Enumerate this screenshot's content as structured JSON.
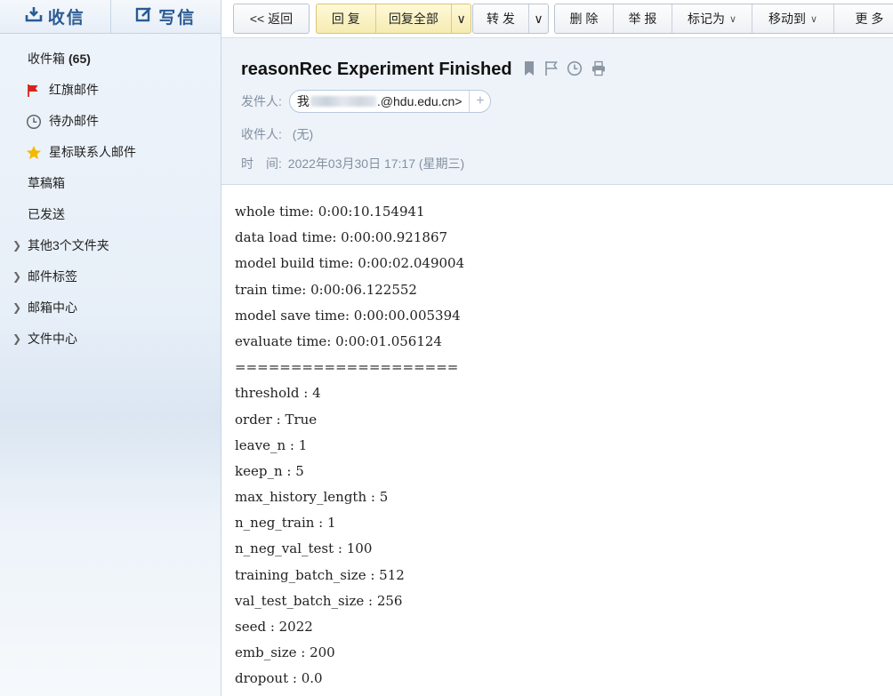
{
  "sidebar": {
    "receive_label": "收信",
    "compose_label": "写信",
    "items": [
      {
        "label": "收件箱",
        "count": "(65)"
      },
      {
        "label": "红旗邮件"
      },
      {
        "label": "待办邮件"
      },
      {
        "label": "星标联系人邮件"
      },
      {
        "label": "草稿箱"
      },
      {
        "label": "已发送"
      },
      {
        "label": "其他3个文件夹"
      },
      {
        "label": "邮件标签"
      },
      {
        "label": "邮箱中心"
      },
      {
        "label": "文件中心"
      }
    ]
  },
  "toolbar": {
    "back": "<< 返回",
    "reply": "回 复",
    "reply_all": "回复全部",
    "forward": "转 发",
    "delete": "删 除",
    "report": "举 报",
    "mark_as": "标记为",
    "move_to": "移动到",
    "more": "更 多"
  },
  "mail": {
    "subject": "reasonRec Experiment Finished",
    "from_label": "发件人:",
    "from_name": "我",
    "from_email_suffix": ".@hdu.edu.cn>",
    "to_label": "收件人:",
    "to_value": "(无)",
    "time_label": "时　间:",
    "time_value": "2022年03月30日 17:17 (星期三)",
    "body_lines": [
      "whole time: 0:00:10.154941",
      "data load time: 0:00:00.921867",
      "model build time: 0:00:02.049004",
      "train time: 0:00:06.122552",
      "model save time: 0:00:00.005394",
      "evaluate time: 0:00:01.056124",
      "====================",
      "threshold : 4",
      "order : True",
      "leave_n : 1",
      "keep_n : 5",
      "max_history_length : 5",
      "n_neg_train : 1",
      "n_neg_val_test : 100",
      "training_batch_size : 512",
      "val_test_batch_size : 256",
      "seed : 2022",
      "emb_size : 200",
      "dropout : 0.0"
    ]
  },
  "colors": {
    "brand_blue": "#2a5a94",
    "flag_red": "#d9231d",
    "star_yellow": "#f5b800"
  }
}
